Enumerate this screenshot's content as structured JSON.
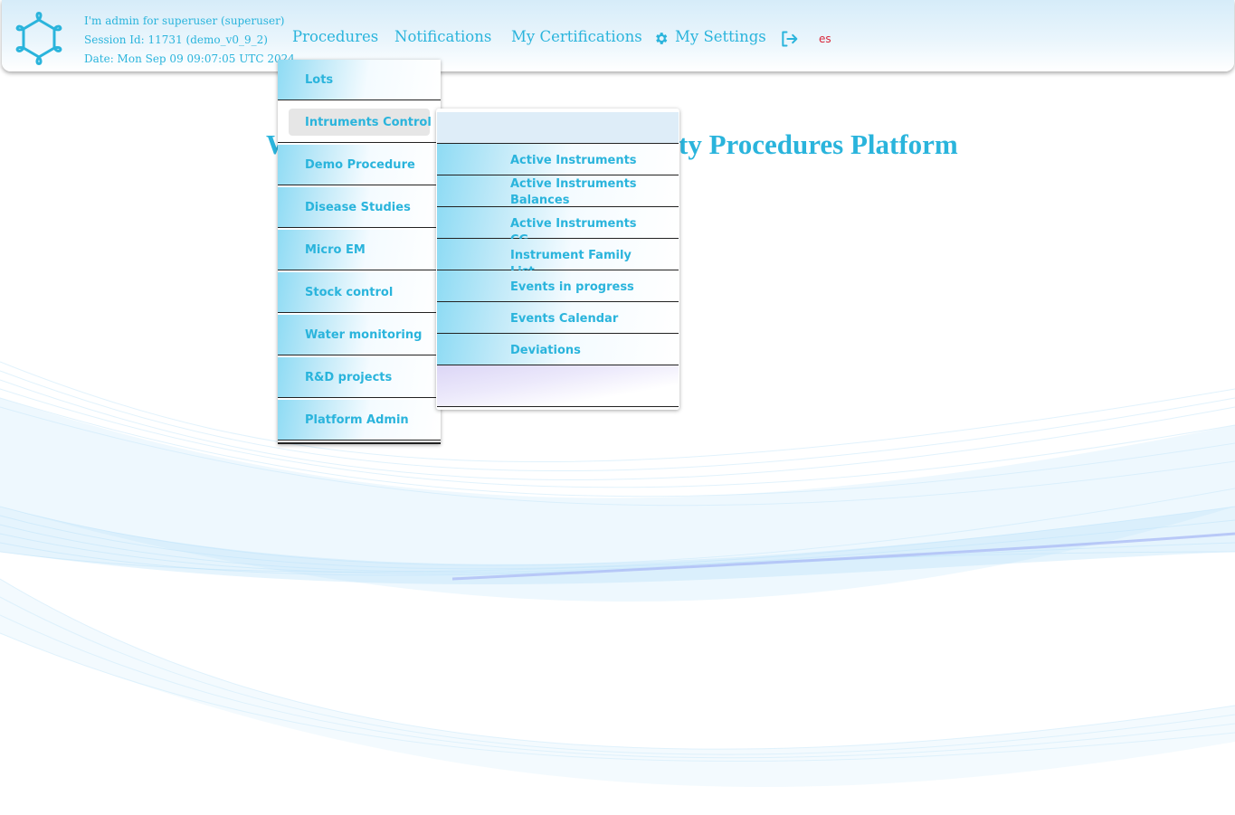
{
  "header": {
    "user_line": "I'm admin for superuser (superuser)",
    "session_line": "Session Id: 11731 (demo_v0_9_2)",
    "date_line": "Date: Mon Sep 09 09:07:05 UTC 2024",
    "nav": {
      "procedures": "Procedures",
      "notifications": "Notifications",
      "certifications": "My Certifications",
      "settings": "My Settings",
      "language": "es"
    }
  },
  "welcome_left": "W",
  "welcome_right": "ty Procedures Platform",
  "procedures_menu": {
    "items": [
      {
        "label": "Lots"
      },
      {
        "label": "Intruments Control"
      },
      {
        "label": "Demo Procedure"
      },
      {
        "label": "Disease Studies"
      },
      {
        "label": "Micro EM"
      },
      {
        "label": "Stock control"
      },
      {
        "label": "Water monitoring"
      },
      {
        "label": "R&D projects"
      },
      {
        "label": "Platform Admin"
      }
    ],
    "active_item": "Intruments Control"
  },
  "submenu": {
    "items": [
      {
        "label": "Active Instruments"
      },
      {
        "label": "Active Instruments Balances"
      },
      {
        "label": "Active Instruments CG"
      },
      {
        "label": "Instrument Family List"
      },
      {
        "label": "Events in progress"
      },
      {
        "label": "Events Calendar"
      },
      {
        "label": "Deviations"
      }
    ]
  },
  "colors": {
    "accent": "#2ab4dc",
    "language": "#d9263a",
    "header_bg": "#d6ecf9"
  },
  "icons": {
    "logo": "molecule-ring-logo",
    "settings": "gear-icon",
    "logout": "logout-arrow-icon"
  }
}
